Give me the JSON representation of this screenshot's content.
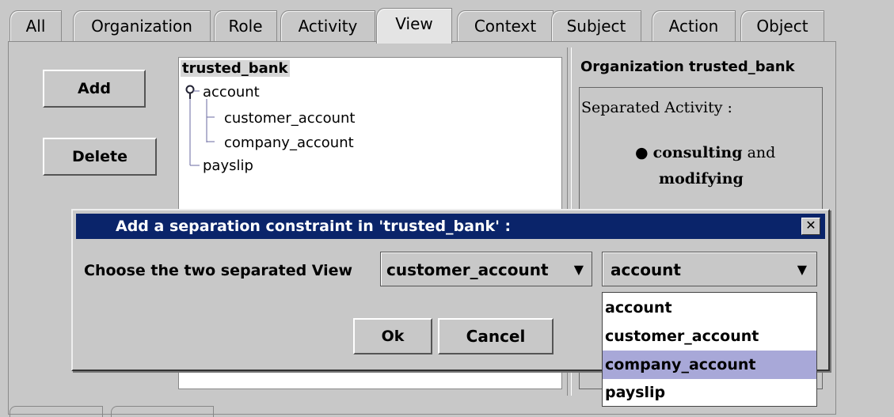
{
  "tabs": [
    "All",
    "Organization",
    "Role",
    "Activity",
    "View",
    "Context",
    "Subject",
    "Action",
    "Object"
  ],
  "active_tab": "View",
  "buttons": {
    "add": "Add",
    "delete": "Delete"
  },
  "tree": {
    "root": "trusted_bank",
    "account": "account",
    "customer_account": "customer_account",
    "company_account": "company_account",
    "payslip": "payslip"
  },
  "info": {
    "header": "Organization trusted_bank",
    "separated_label": "Separated Activity :",
    "bullet_word1": "consulting",
    "bullet_and": " and",
    "bullet_word2": "modifying"
  },
  "dialog": {
    "title": "Add a separation constraint in 'trusted_bank' :",
    "choose_label": "Choose the two separated View",
    "combo1_value": "customer_account",
    "combo2_value": "account",
    "ok": "Ok",
    "cancel": "Cancel",
    "options": [
      "account",
      "customer_account",
      "company_account",
      "payslip"
    ],
    "highlighted_option": "company_account"
  },
  "colors": {
    "titlebar": "#0a246a",
    "highlight": "#a8a8d8"
  }
}
